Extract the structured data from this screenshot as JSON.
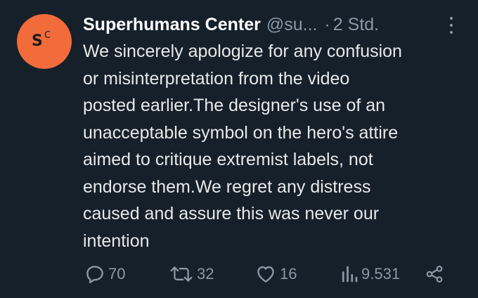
{
  "tweet": {
    "author": {
      "display_name": "Superhumans Center",
      "handle": "@su...",
      "avatar_logo_big": "S",
      "avatar_logo_small": "C",
      "avatar_color": "#f26b3a"
    },
    "separator": "·",
    "time": "2 Std.",
    "text": "We sincerely apologize for any confusion\nor misinterpretation from the video\nposted earlier.The designer's use of an\nunacceptable symbol on the hero's attire\naimed to critique extremist labels, not\nendorse them.We regret any distress\ncaused and assure this was never our\nintention",
    "actions": {
      "reply": {
        "icon": "reply-icon",
        "count": "70"
      },
      "retweet": {
        "icon": "retweet-icon",
        "count": "32"
      },
      "like": {
        "icon": "heart-icon",
        "count": "16"
      },
      "views": {
        "icon": "views-icon",
        "count": "9.531"
      },
      "share": {
        "icon": "share-icon"
      }
    },
    "more_icon": "more-options-icon"
  },
  "theme": {
    "background": "#15202b",
    "text": "#e7e9ea",
    "muted": "#8b98a5"
  }
}
